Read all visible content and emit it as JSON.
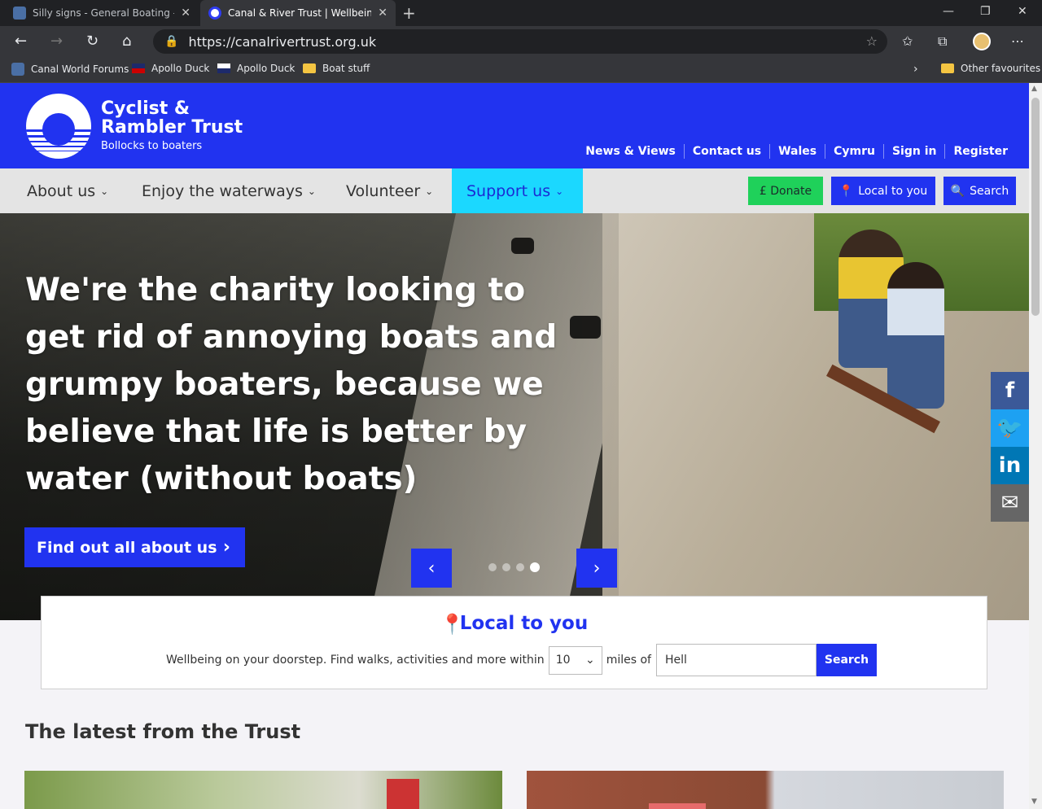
{
  "browser": {
    "tabs": [
      {
        "title": "Silly signs - General Boating - Ca",
        "active": false
      },
      {
        "title": "Canal & River Trust | Wellbeing f",
        "active": true
      }
    ],
    "url": "https://canalrivertrust.org.uk",
    "bookmarks": [
      {
        "label": "Canal World Forums"
      },
      {
        "label": "Apollo Duck"
      },
      {
        "label": "Apollo Duck"
      },
      {
        "label": "Boat stuff"
      }
    ],
    "other_favourites": "Other favourites"
  },
  "site": {
    "brand_line1": "Cyclist &",
    "brand_line2": "Rambler Trust",
    "tagline": "Bollocks to boaters",
    "top_links": [
      "News & Views",
      "Contact us",
      "Wales",
      "Cymru",
      "Sign in",
      "Register"
    ],
    "nav": [
      "About us",
      "Enjoy the waterways",
      "Volunteer",
      "Support us"
    ],
    "active_nav": "Support us",
    "donate": "£  Donate",
    "local_btn": "Local to you",
    "search_btn": "Search",
    "colors": {
      "brand": "#2133f0",
      "active_nav": "#1bd8ff",
      "donate": "#1fd15a"
    }
  },
  "hero": {
    "headline": "We're the charity looking to get rid of annoying boats and grumpy boaters, because we believe that life is better by water (without boats)",
    "cta": "Find out all about us",
    "slides_total": 4,
    "slide_active": 4
  },
  "local": {
    "title": "Local to you",
    "prefix": "Wellbeing on your doorstep. Find walks, activities and more within",
    "miles_value": "10",
    "miles_label": "miles of",
    "place_value": "Hell",
    "search": "Search"
  },
  "latest": {
    "heading": "The latest from the Trust"
  }
}
